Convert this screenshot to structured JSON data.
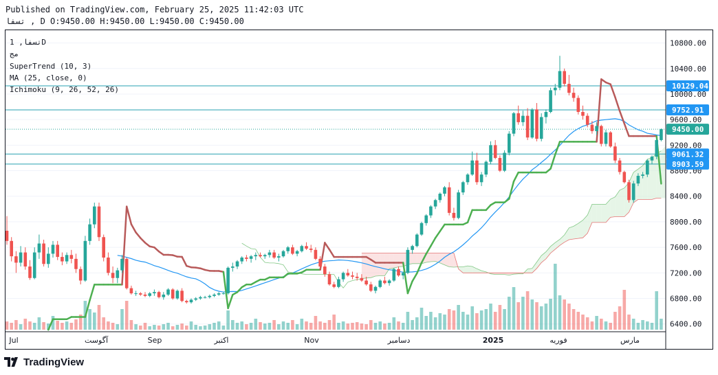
{
  "header": {
    "published": "Published on TradingView.com, February 25, 2025 11:42:03 UTC",
    "ohlc_line": "تسفا , D O:9450.00 H:9450.00 L:9450.00 C:9450.00"
  },
  "footer": {
    "brand": "TradingView",
    "logo_icon": "tradingview-logo-icon"
  },
  "chart_data": {
    "type": "candlestick",
    "legend": {
      "symbol": "تسفا, 1D",
      "exchange": "مج",
      "indicators": [
        "SuperTrend (10, 3)",
        "MA (25, close, 0)",
        "Ichimoku (9, 26, 52, 26)"
      ]
    },
    "y_axis": {
      "ticks": [
        6400,
        6800,
        7200,
        7600,
        8000,
        8400,
        8800,
        9200,
        9600,
        10000,
        10400,
        10800
      ],
      "labels": [
        "6400.00",
        "6800.00",
        "7200.00",
        "7600.00",
        "8000.00",
        "8400.00",
        "8800.00",
        "9200.00",
        "9600.00",
        "10000.00",
        "10400.00",
        "10800.00"
      ],
      "range": [
        6300,
        11000
      ]
    },
    "x_axis": {
      "labels": [
        "Jul",
        "آگوست",
        "Sep",
        "اکتبر",
        "Nov",
        "دسامبر",
        "2025",
        "فوریه",
        "مارس"
      ]
    },
    "price_lines": [
      {
        "value": 10129.04,
        "label": "10129.04",
        "style": "solid",
        "color": "#26a0b0"
      },
      {
        "value": 9752.91,
        "label": "9752.91",
        "style": "solid",
        "color": "#26a0b0"
      },
      {
        "value": 9450.0,
        "label": "9450.00",
        "style": "dotted",
        "color": "#26a69a",
        "badge_color": "#26a69a"
      },
      {
        "value": 9061.32,
        "label": "9061.32",
        "style": "solid",
        "color": "#26a0b0"
      },
      {
        "value": 8903.59,
        "label": "8903.59",
        "style": "solid",
        "color": "#26a0b0"
      }
    ],
    "colors": {
      "up": "#26a69a",
      "down": "#ef5350",
      "st_up": "#4caf50",
      "st_down": "#b85a5a",
      "ma": "#2196f3",
      "cloud_up": "#d6eed7",
      "cloud_down": "#f9d0d0",
      "axis_badge": "#2196f3"
    },
    "candles": [
      [
        7860,
        8090,
        7640,
        7700
      ],
      [
        7700,
        7760,
        7380,
        7460
      ],
      [
        7460,
        7540,
        7200,
        7360
      ],
      [
        7360,
        7620,
        7300,
        7520
      ],
      [
        7520,
        7600,
        7250,
        7300
      ],
      [
        7300,
        7400,
        7090,
        7120
      ],
      [
        7120,
        7600,
        7100,
        7520
      ],
      [
        7520,
        7800,
        7420,
        7660
      ],
      [
        7660,
        7720,
        7300,
        7340
      ],
      [
        7340,
        7600,
        7280,
        7500
      ],
      [
        7500,
        7700,
        7440,
        7640
      ],
      [
        7640,
        7700,
        7400,
        7450
      ],
      [
        7450,
        7520,
        7320,
        7380
      ],
      [
        7380,
        7520,
        7340,
        7480
      ],
      [
        7480,
        7560,
        7350,
        7420
      ],
      [
        7420,
        7500,
        7200,
        7260
      ],
      [
        7260,
        7300,
        7020,
        7080
      ],
      [
        7080,
        7780,
        7060,
        7700
      ],
      [
        7700,
        8050,
        7640,
        7960
      ],
      [
        7960,
        8300,
        7900,
        8240
      ],
      [
        8240,
        8300,
        7700,
        7760
      ],
      [
        7760,
        7800,
        7380,
        7440
      ],
      [
        7440,
        7520,
        7160,
        7200
      ],
      [
        7200,
        7300,
        7040,
        7120
      ],
      [
        7120,
        7280,
        7040,
        7240
      ],
      [
        7240,
        7480,
        7200,
        7420
      ],
      [
        7420,
        7440,
        6940,
        6960
      ],
      [
        6960,
        7000,
        6860,
        6880
      ],
      [
        6880,
        6920,
        6840,
        6880
      ],
      [
        6880,
        6900,
        6840,
        6860
      ],
      [
        6860,
        6900,
        6820,
        6840
      ],
      [
        6840,
        6900,
        6820,
        6880
      ],
      [
        6880,
        6940,
        6840,
        6900
      ],
      [
        6900,
        6920,
        6800,
        6820
      ],
      [
        6820,
        6900,
        6780,
        6860
      ],
      [
        6860,
        6960,
        6840,
        6940
      ],
      [
        6940,
        6960,
        6780,
        6800
      ],
      [
        6800,
        6940,
        6780,
        6920
      ],
      [
        6920,
        6960,
        6740,
        6760
      ],
      [
        6760,
        6780,
        6720,
        6740
      ],
      [
        6740,
        6800,
        6720,
        6780
      ],
      [
        6780,
        6820,
        6760,
        6800
      ],
      [
        6800,
        6840,
        6780,
        6820
      ],
      [
        6820,
        6840,
        6800,
        6820
      ],
      [
        6820,
        6860,
        6800,
        6840
      ],
      [
        6840,
        6880,
        6820,
        6860
      ],
      [
        6860,
        6900,
        6840,
        6880
      ],
      [
        6880,
        6900,
        6860,
        6880
      ],
      [
        6880,
        7300,
        6860,
        7280
      ],
      [
        7280,
        7360,
        7220,
        7300
      ],
      [
        7300,
        7400,
        7260,
        7380
      ],
      [
        7380,
        7460,
        7340,
        7440
      ],
      [
        7440,
        7480,
        7380,
        7420
      ],
      [
        7420,
        7480,
        7360,
        7460
      ],
      [
        7460,
        7520,
        7400,
        7480
      ],
      [
        7480,
        7520,
        7440,
        7460
      ],
      [
        7460,
        7500,
        7420,
        7480
      ],
      [
        7480,
        7560,
        7440,
        7520
      ],
      [
        7520,
        7560,
        7420,
        7440
      ],
      [
        7440,
        7500,
        7380,
        7460
      ],
      [
        7460,
        7560,
        7440,
        7540
      ],
      [
        7540,
        7620,
        7500,
        7600
      ],
      [
        7600,
        7640,
        7480,
        7500
      ],
      [
        7500,
        7560,
        7460,
        7540
      ],
      [
        7540,
        7640,
        7520,
        7620
      ],
      [
        7620,
        7680,
        7560,
        7580
      ],
      [
        7580,
        7640,
        7520,
        7560
      ],
      [
        7560,
        7600,
        7400,
        7420
      ],
      [
        7420,
        7460,
        7260,
        7300
      ],
      [
        7300,
        7340,
        7140,
        7180
      ],
      [
        7180,
        7220,
        7000,
        7020
      ],
      [
        7020,
        7060,
        6960,
        6980
      ],
      [
        6980,
        7140,
        6960,
        7100
      ],
      [
        7100,
        7220,
        7060,
        7200
      ],
      [
        7200,
        7260,
        7140,
        7160
      ],
      [
        7160,
        7220,
        7100,
        7140
      ],
      [
        7140,
        7200,
        7080,
        7120
      ],
      [
        7120,
        7180,
        7060,
        7080
      ],
      [
        7080,
        7140,
        7000,
        7020
      ],
      [
        7020,
        7060,
        6900,
        6920
      ],
      [
        6920,
        7000,
        6880,
        6980
      ],
      [
        6980,
        7100,
        6960,
        7080
      ],
      [
        7080,
        7140,
        7020,
        7040
      ],
      [
        7040,
        7100,
        7000,
        7080
      ],
      [
        7080,
        7280,
        7060,
        7260
      ],
      [
        7260,
        7300,
        7140,
        7160
      ],
      [
        7160,
        7220,
        7100,
        7200
      ],
      [
        7200,
        7600,
        7180,
        7560
      ],
      [
        7560,
        7640,
        7500,
        7620
      ],
      [
        7620,
        7820,
        7600,
        7800
      ],
      [
        7800,
        8000,
        7780,
        7980
      ],
      [
        7980,
        8120,
        7940,
        8100
      ],
      [
        8100,
        8260,
        8060,
        8240
      ],
      [
        8240,
        8360,
        8200,
        8340
      ],
      [
        8340,
        8460,
        8300,
        8440
      ],
      [
        8440,
        8560,
        8400,
        8540
      ],
      [
        8540,
        8620,
        8100,
        8140
      ],
      [
        8140,
        8220,
        8020,
        8060
      ],
      [
        8060,
        8500,
        8040,
        8460
      ],
      [
        8460,
        8640,
        8420,
        8620
      ],
      [
        8620,
        8760,
        8580,
        8740
      ],
      [
        8740,
        9100,
        8720,
        8960
      ],
      [
        8960,
        9080,
        8580,
        8620
      ],
      [
        8620,
        8780,
        8560,
        8740
      ],
      [
        8740,
        8960,
        8700,
        8940
      ],
      [
        8940,
        9260,
        8900,
        9200
      ],
      [
        9200,
        9280,
        8980,
        9000
      ],
      [
        9000,
        9040,
        8780,
        8800
      ],
      [
        8800,
        9120,
        8780,
        9080
      ],
      [
        9080,
        9420,
        9040,
        9380
      ],
      [
        9380,
        9720,
        9340,
        9700
      ],
      [
        9700,
        9820,
        9520,
        9560
      ],
      [
        9560,
        9740,
        9500,
        9660
      ],
      [
        9660,
        9780,
        9280,
        9320
      ],
      [
        9320,
        9780,
        9300,
        9760
      ],
      [
        9760,
        9860,
        9260,
        9300
      ],
      [
        9300,
        9700,
        9260,
        9640
      ],
      [
        9640,
        9760,
        9540,
        9720
      ],
      [
        9720,
        10100,
        9700,
        10060
      ],
      [
        10060,
        10160,
        9980,
        10100
      ],
      [
        10100,
        10600,
        10060,
        10360
      ],
      [
        10360,
        10400,
        10120,
        10160
      ],
      [
        10160,
        10300,
        9980,
        10020
      ],
      [
        10020,
        10100,
        9880,
        9940
      ],
      [
        9940,
        9980,
        9680,
        9720
      ],
      [
        9720,
        9820,
        9600,
        9660
      ],
      [
        9660,
        9700,
        9480,
        9520
      ],
      [
        9520,
        9580,
        9380,
        9420
      ],
      [
        9420,
        9560,
        9360,
        9500
      ],
      [
        9500,
        9520,
        9180,
        9220
      ],
      [
        9220,
        9440,
        9180,
        9400
      ],
      [
        9400,
        9420,
        9160,
        9180
      ],
      [
        9180,
        9240,
        8920,
        8960
      ],
      [
        8960,
        9000,
        8740,
        8780
      ],
      [
        8780,
        8800,
        8600,
        8620
      ],
      [
        8620,
        8660,
        8300,
        8340
      ],
      [
        8340,
        8640,
        8300,
        8600
      ],
      [
        8600,
        8760,
        8560,
        8720
      ],
      [
        8720,
        8780,
        8680,
        8740
      ],
      [
        8740,
        8980,
        8700,
        8960
      ],
      [
        8960,
        9040,
        8900,
        9020
      ],
      [
        9020,
        9300,
        8980,
        9280
      ],
      [
        9280,
        9460,
        9260,
        9450
      ]
    ],
    "volume": [
      0.12,
      0.1,
      0.14,
      0.08,
      0.16,
      0.12,
      0.1,
      0.18,
      0.11,
      0.09,
      0.2,
      0.13,
      0.1,
      0.12,
      0.1,
      0.15,
      0.22,
      0.42,
      0.3,
      0.25,
      0.36,
      0.18,
      0.12,
      0.1,
      0.08,
      0.3,
      0.42,
      0.14,
      0.08,
      0.06,
      0.1,
      0.05,
      0.07,
      0.06,
      0.08,
      0.1,
      0.05,
      0.07,
      0.09,
      0.06,
      0.12,
      0.07,
      0.05,
      0.06,
      0.08,
      0.1,
      0.12,
      0.06,
      0.28,
      0.14,
      0.1,
      0.12,
      0.08,
      0.1,
      0.16,
      0.11,
      0.09,
      0.1,
      0.14,
      0.08,
      0.12,
      0.1,
      0.14,
      0.08,
      0.16,
      0.12,
      0.1,
      0.2,
      0.12,
      0.1,
      0.14,
      0.22,
      0.1,
      0.12,
      0.09,
      0.1,
      0.11,
      0.09,
      0.08,
      0.14,
      0.1,
      0.12,
      0.09,
      0.1,
      0.18,
      0.12,
      0.1,
      0.26,
      0.14,
      0.18,
      0.32,
      0.2,
      0.26,
      0.18,
      0.24,
      0.22,
      0.3,
      0.28,
      0.36,
      0.26,
      0.22,
      0.34,
      0.24,
      0.28,
      0.3,
      0.38,
      0.26,
      0.36,
      0.3,
      0.48,
      0.62,
      0.4,
      0.48,
      0.56,
      0.44,
      0.4,
      0.34,
      0.38,
      0.45,
      0.96,
      0.5,
      0.44,
      0.38,
      0.3,
      0.26,
      0.22,
      0.18,
      0.12,
      0.2,
      0.16,
      0.12,
      0.1,
      0.26,
      0.34,
      0.58,
      0.22,
      0.16,
      0.1,
      0.14,
      0.12,
      0.1,
      0.56,
      0.16
    ],
    "xlabel": "",
    "ylabel": ""
  }
}
